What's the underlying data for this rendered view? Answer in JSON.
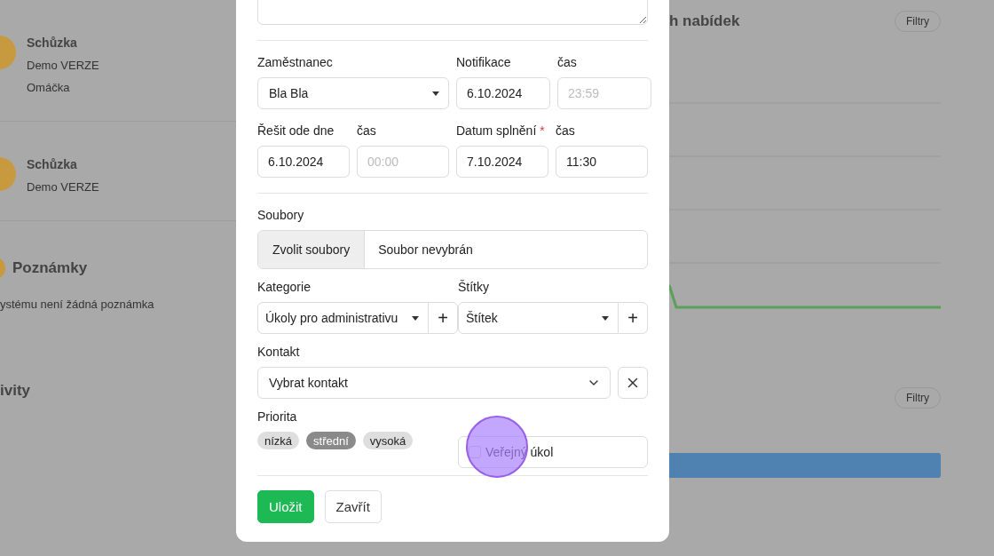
{
  "backdrop": {
    "left_items": [
      {
        "title": "Schůzka",
        "lines": [
          "Demo VERZE",
          "Omáčka"
        ]
      },
      {
        "title": "Schůzka",
        "lines": [
          "Demo VERZE"
        ]
      }
    ],
    "notes_title": "Poznámky",
    "notes_empty": "ystému není žádná poznámka",
    "activity_title": "ivity",
    "chart_title": "h nabídek",
    "filter_buttons": [
      "Filtry",
      "Filtry"
    ]
  },
  "form": {
    "employee": {
      "label": "Zaměstnanec",
      "value": "Bla Bla"
    },
    "notification": {
      "label": "Notifikace",
      "value": "6.10.2024"
    },
    "notification_time": {
      "label": "čas",
      "placeholder": "23:59"
    },
    "start": {
      "label": "Řešit ode dne",
      "value": "6.10.2024"
    },
    "start_time": {
      "label": "čas",
      "placeholder": "00:00"
    },
    "due": {
      "label": "Datum splnění",
      "required_mark": "*",
      "value": "7.10.2024"
    },
    "due_time": {
      "label": "čas",
      "value": "11:30"
    },
    "files": {
      "label": "Soubory",
      "button": "Zvolit soubory",
      "status": "Soubor nevybrán"
    },
    "category": {
      "label": "Kategorie",
      "value": "Úkoly pro administrativu",
      "add": "+"
    },
    "tags": {
      "label": "Štítky",
      "value": "Štítek",
      "add": "+"
    },
    "contact": {
      "label": "Kontakt",
      "value": "Vybrat kontakt"
    },
    "priority": {
      "label": "Priorita",
      "options": [
        {
          "label": "nízká",
          "selected": false
        },
        {
          "label": "střední",
          "selected": true
        },
        {
          "label": "vysoká",
          "selected": false
        }
      ]
    },
    "public": {
      "label": "Veřejný úkol",
      "checked": false
    },
    "buttons": [
      {
        "label": "Uložit",
        "kind": "primary"
      },
      {
        "label": "Zavřít",
        "kind": "secondary"
      }
    ]
  },
  "touch_indicator": true
}
